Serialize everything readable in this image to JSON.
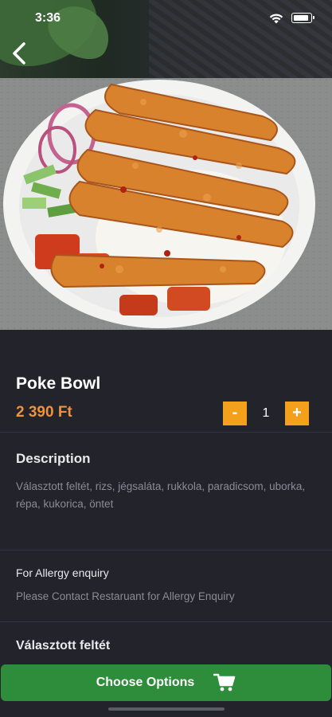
{
  "status_bar": {
    "time": "3:36"
  },
  "header": {
    "back_icon": "chevron-left-icon"
  },
  "product": {
    "name": "Poke Bowl",
    "price": "2 390 Ft",
    "quantity": "1",
    "minus_label": "-",
    "plus_label": "+"
  },
  "description": {
    "title": "Description",
    "text": "Választott feltét, rizs, jégsaláta, rukkola, paradicsom, uborka, répa, kukorica, öntet"
  },
  "allergy": {
    "title": "For Allergy enquiry",
    "text": "Please Contact Restaruant for Allergy Enquiry"
  },
  "options_heading": "Választott feltét",
  "footer": {
    "button_label": "Choose Options",
    "button_icon": "cart-icon",
    "button_color": "#2d8d3a"
  },
  "colors": {
    "accent": "#f3a11c",
    "price": "#f0913c",
    "background": "#22232b"
  }
}
